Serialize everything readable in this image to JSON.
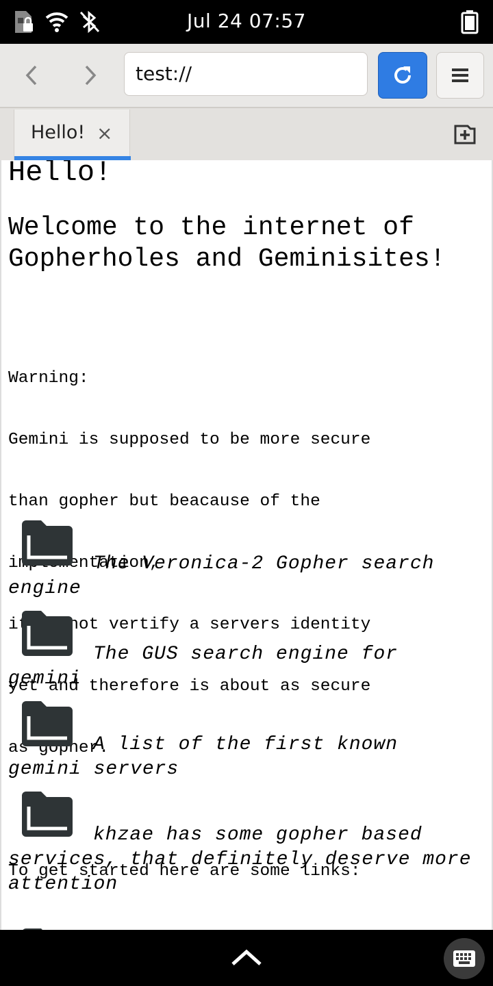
{
  "status_bar": {
    "date_time": "Jul 24  07:57",
    "icons": [
      "sim-lock-icon",
      "wifi-icon",
      "bluetooth-off-icon",
      "battery-icon"
    ]
  },
  "toolbar": {
    "back_icon": "chevron-left-icon",
    "forward_icon": "chevron-right-icon",
    "url": "test://",
    "reload_icon": "reload-icon",
    "menu_icon": "hamburger-menu-icon"
  },
  "tabs": [
    {
      "label": "Hello!",
      "close": "×"
    }
  ],
  "new_tab_icon": "new-tab-icon",
  "page": {
    "heading": "Hello!",
    "subheading": "Welcome to the internet of Gopherholes and Geminisites!",
    "warning_lines": [
      "Warning:",
      "Gemini is supposed to be more secure",
      "than gopher but beacause of the",
      "implementation,",
      "it cannot vertify a servers identity",
      "yet and therefore is about as secure",
      "as gopher.",
      "",
      "To get started here are some links:"
    ],
    "links": [
      {
        "icon": "folder-icon",
        "text": "The Veronica-2 Gopher search engine"
      },
      {
        "icon": "folder-icon",
        "text": "The GUS search engine for gemini"
      },
      {
        "icon": "folder-icon",
        "text": "A list of the first known gemini servers"
      },
      {
        "icon": "folder-icon",
        "text": "khzae has some gopher based services, that definitely deserve more attention"
      }
    ]
  },
  "bottom_bar": {
    "handle_icon": "chevron-up-icon",
    "keyboard_icon": "keyboard-icon"
  }
}
